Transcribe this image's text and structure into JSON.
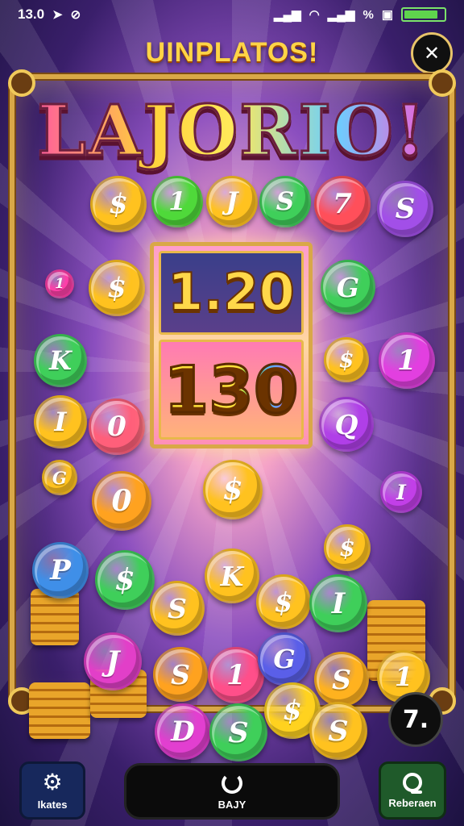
{
  "status_bar": {
    "time": "13.0",
    "battery_label": "",
    "battery_level": 0.85,
    "left_icons": [
      "navigation-icon",
      "no-notifications-icon"
    ],
    "right_icons": [
      "signal-icon",
      "wifi-icon",
      "signal-icon",
      "percent-icon",
      "save-icon"
    ]
  },
  "header": {
    "title": "UINPLATOS!",
    "close_symbol": "✕"
  },
  "logo": {
    "text": "LAJORIO!"
  },
  "panel": {
    "top_value": "1.20",
    "bottom_value": "130"
  },
  "coins": [
    {
      "symbol": "$",
      "color": "#ffc21f"
    },
    {
      "symbol": "1",
      "color": "#4fd93a"
    },
    {
      "symbol": "J",
      "color": "#ffc21f"
    },
    {
      "symbol": "S",
      "color": "#3fcf5a"
    },
    {
      "symbol": "7",
      "color": "#ff4f5a"
    },
    {
      "symbol": "S",
      "color": "#a24fe8"
    },
    {
      "symbol": "1",
      "color": "#ff3fa8"
    },
    {
      "symbol": "$",
      "color": "#ffc21f"
    },
    {
      "symbol": "G",
      "color": "#3fcf5a"
    },
    {
      "symbol": "K",
      "color": "#3fcf5a"
    },
    {
      "symbol": "$",
      "color": "#ffc21f"
    },
    {
      "symbol": "1",
      "color": "#e23fe0"
    },
    {
      "symbol": "I",
      "color": "#ffc21f"
    },
    {
      "symbol": "0",
      "color": "#ff5f7a"
    },
    {
      "symbol": "Q",
      "color": "#b03fe8"
    },
    {
      "symbol": "0",
      "color": "#ffa21f"
    },
    {
      "symbol": "$",
      "color": "#ffc21f"
    },
    {
      "symbol": "G",
      "color": "#ffc21f"
    },
    {
      "symbol": "I",
      "color": "#c23fe8"
    },
    {
      "symbol": "P",
      "color": "#3f8fe8"
    },
    {
      "symbol": "$",
      "color": "#3fcf5a"
    },
    {
      "symbol": "S",
      "color": "#ffc21f"
    },
    {
      "symbol": "K",
      "color": "#ffc21f"
    },
    {
      "symbol": "$",
      "color": "#ffc21f"
    },
    {
      "symbol": "I",
      "color": "#3fcf5a"
    },
    {
      "symbol": "$",
      "color": "#ffc21f"
    },
    {
      "symbol": "J",
      "color": "#e23fc8"
    },
    {
      "symbol": "S",
      "color": "#ffa21f"
    },
    {
      "symbol": "1",
      "color": "#ff4f8a"
    },
    {
      "symbol": "G",
      "color": "#5a5fe8"
    },
    {
      "symbol": "S",
      "color": "#ffb21f"
    },
    {
      "symbol": "1",
      "color": "#ffc21f"
    },
    {
      "symbol": "D",
      "color": "#e23fd0"
    },
    {
      "symbol": "S",
      "color": "#3fcf5a"
    },
    {
      "symbol": "$",
      "color": "#ffd21f"
    },
    {
      "symbol": "S",
      "color": "#ffc21f"
    }
  ],
  "badge": {
    "label": "7."
  },
  "bottom": {
    "left_label": "Ikates",
    "left_icon": "gear-icon",
    "center_label": "BAJY",
    "center_icon": "spinner-icon",
    "right_label": "Reberaen",
    "right_icon": "search-icon"
  }
}
